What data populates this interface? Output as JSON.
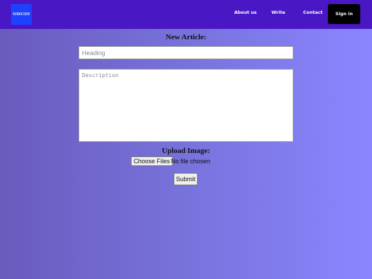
{
  "navbar": {
    "logo_text": "ROBOCODE",
    "links": [
      "About us",
      "Write",
      "Contact"
    ],
    "signin_label": "Sign in",
    "colors": {
      "bar": "#4a17c4",
      "logo": "#1e40ff",
      "signin": "#000000"
    }
  },
  "form": {
    "title": "New Article:",
    "heading_placeholder": "Heading",
    "description_placeholder": "Description",
    "upload_label": "Upload Image:",
    "choose_files_label": "Choose Files",
    "file_status": "No file chosen",
    "submit_label": "Submit"
  }
}
